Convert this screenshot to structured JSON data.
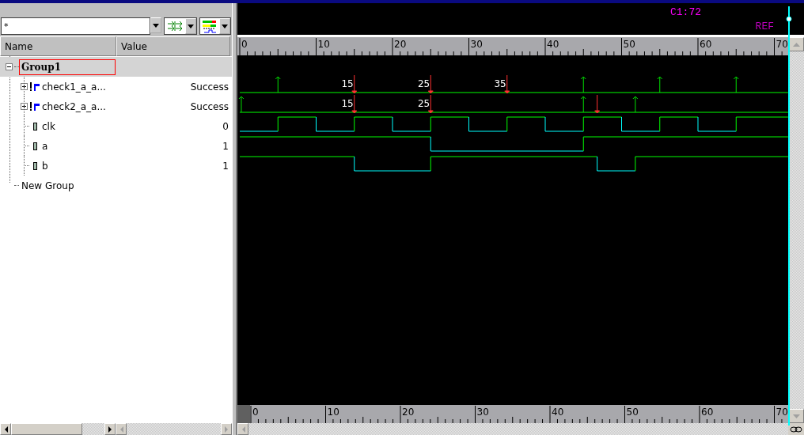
{
  "filter": {
    "value": "*"
  },
  "columns": [
    "Name",
    "Value"
  ],
  "tree": [
    {
      "label": "Group1",
      "kind": "group",
      "selected": true,
      "expanded": true,
      "children": [
        {
          "label": "check1_a_a...",
          "kind": "assertion",
          "value": "Success",
          "selected": false,
          "expanded": false
        },
        {
          "label": "check2_a_a...",
          "kind": "assertion",
          "value": "Success",
          "selected": false,
          "expanded": false
        },
        {
          "label": "clk",
          "kind": "signal",
          "value": "0",
          "selected": false
        },
        {
          "label": "a",
          "kind": "signal",
          "value": "1",
          "selected": false
        },
        {
          "label": "b",
          "kind": "signal",
          "value": "1",
          "selected": false
        }
      ]
    },
    {
      "label": "New Group",
      "kind": "group",
      "selected": false
    }
  ],
  "cursor": {
    "label": "C1:72",
    "reference": "REF"
  },
  "ruler": {
    "labels": [
      "0",
      "10",
      "20",
      "30",
      "40",
      "50",
      "60",
      "70"
    ]
  },
  "waves": [
    {
      "kind": "assertion",
      "fail_labels": [
        "15",
        "25",
        "35"
      ]
    },
    {
      "kind": "assertion",
      "fail_labels": [
        "15",
        "25"
      ]
    },
    {
      "kind": "clock"
    },
    {
      "kind": "bit"
    },
    {
      "kind": "bit"
    }
  ],
  "bottom_ruler": {
    "labels": [
      "0",
      "10",
      "20",
      "30",
      "40",
      "50",
      "60",
      "70"
    ]
  }
}
